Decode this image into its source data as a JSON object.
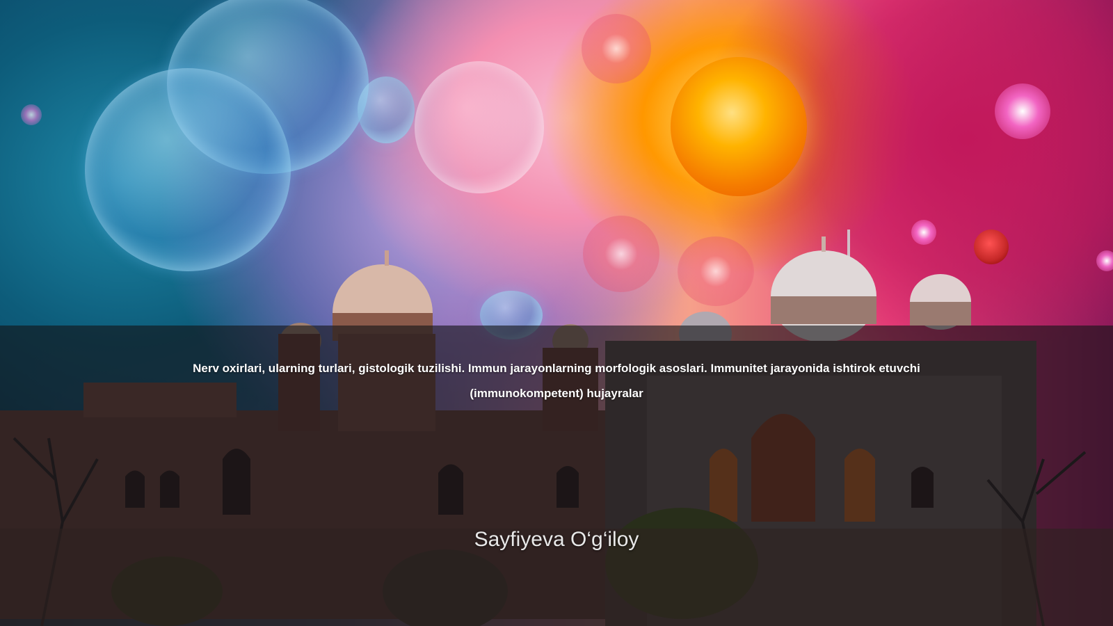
{
  "slide": {
    "title": "Nerv oxirlari, ularning turlari, gistologik tuzilishi. Immun jarayonlarning morfologik asoslari. Immunitet jarayonida ishtirok etuvchi (immunokompetent) hujayralar",
    "author": "Sayfiyeva O‘g‘iloy"
  },
  "background": {
    "description_icon": "cosmic-cells-over-palace-image",
    "colors": {
      "left": "#0a3f5e",
      "center": "#f6a08a",
      "right": "#8e1a5a",
      "overlay": "#141416"
    }
  }
}
